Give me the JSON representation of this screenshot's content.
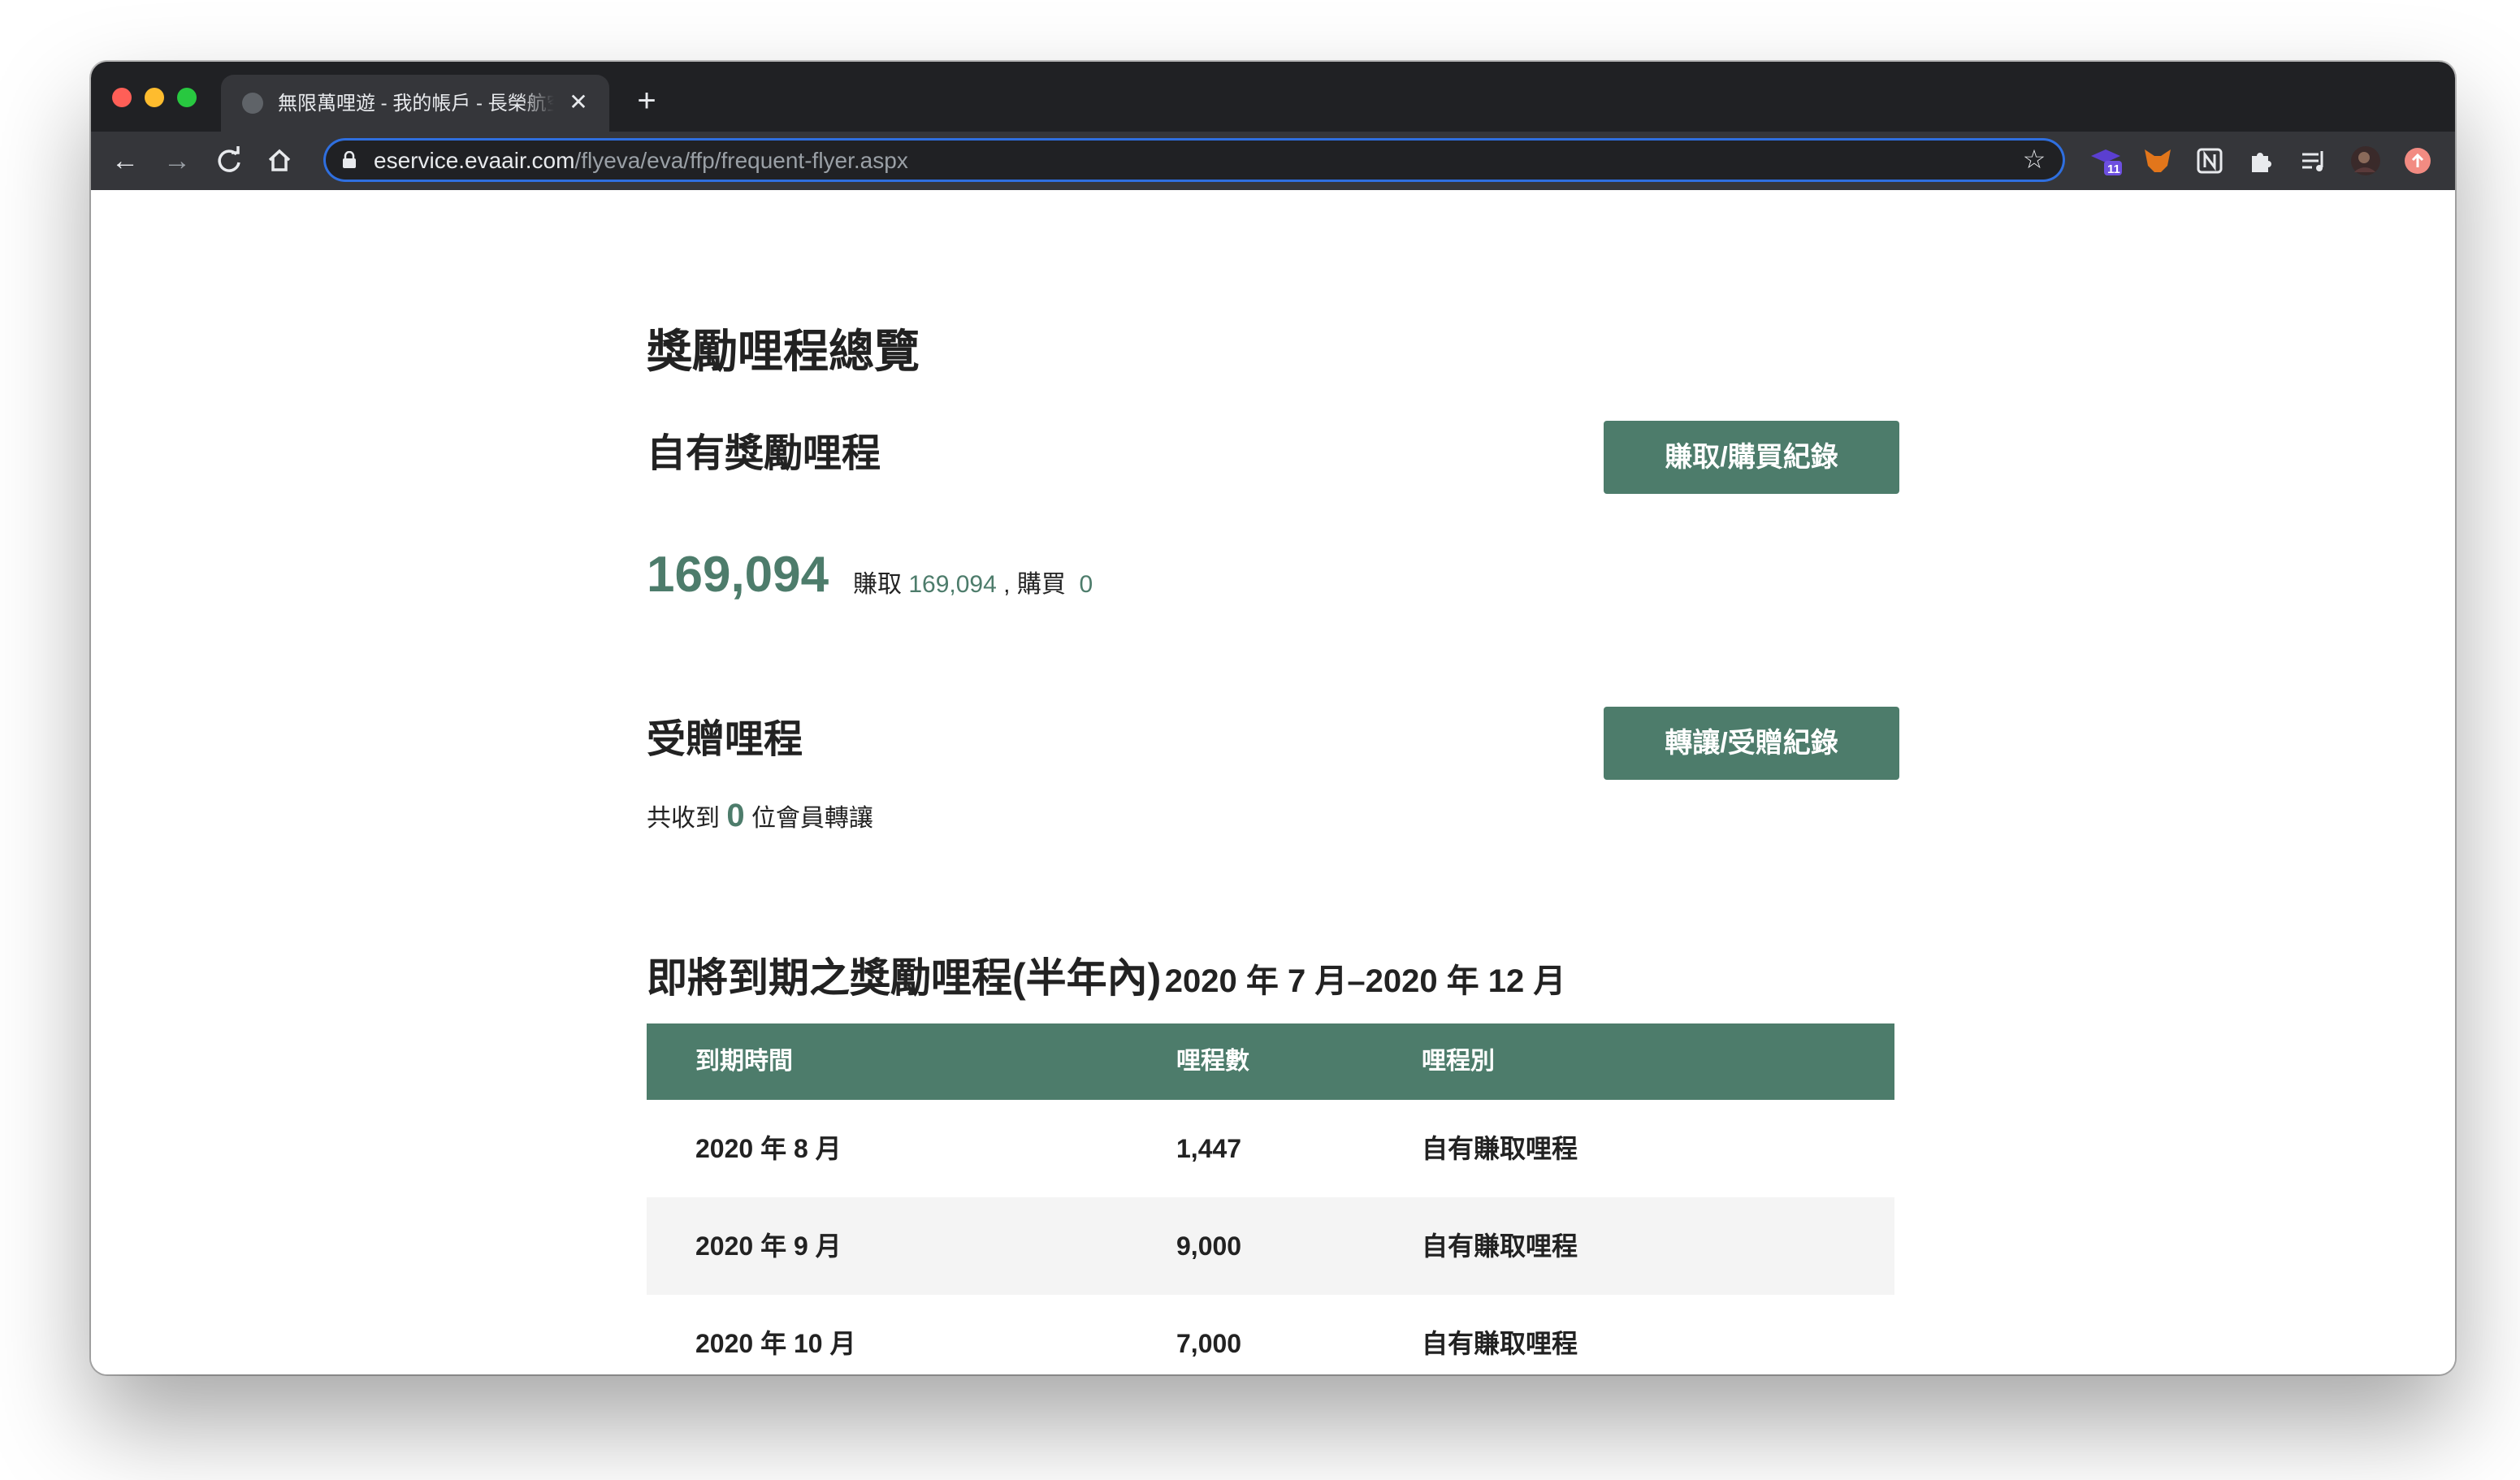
{
  "browser": {
    "tab_title": "無限萬哩遊 - 我的帳戶 - 長榮航空",
    "url_host": "eservice.evaair.com",
    "url_path": "/flyeva/eva/ffp/frequent-flyer.aspx",
    "extension_badge": "11"
  },
  "page": {
    "title": "獎勵哩程總覽",
    "own": {
      "heading": "自有獎勵哩程",
      "button": "賺取/購買紀錄",
      "total": "169,094",
      "earn_label": "賺取",
      "earn_value": "169,094",
      "sep": ",",
      "buy_label": "購買",
      "buy_value": "0"
    },
    "gift": {
      "heading": "受贈哩程",
      "button": "轉讓/受贈紀錄",
      "prefix": "共收到",
      "count": "0",
      "suffix": "位會員轉讓"
    },
    "expiring": {
      "heading": "即將到期之獎勵哩程(半年內)",
      "range": "2020 年 7 月–2020 年 12 月",
      "columns": [
        "到期時間",
        "哩程數",
        "哩程別"
      ],
      "rows": [
        [
          "2020 年 8 月",
          "1,447",
          "自有賺取哩程"
        ],
        [
          "2020 年 9 月",
          "9,000",
          "自有賺取哩程"
        ],
        [
          "2020 年 10 月",
          "7,000",
          "自有賺取哩程"
        ]
      ]
    }
  },
  "colors": {
    "accent": "#4d7c6b",
    "chrome_dark": "#202124",
    "chrome_tab": "#35363a",
    "row_alt": "#f4f4f4"
  }
}
